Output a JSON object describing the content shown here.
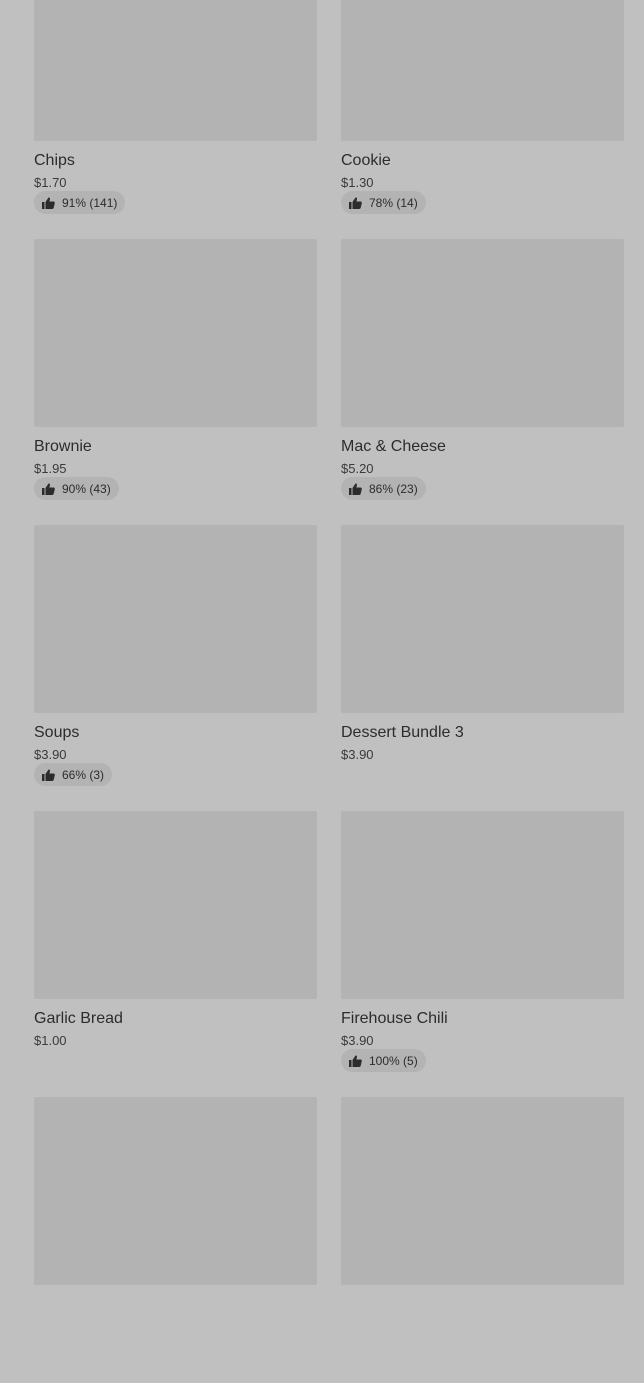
{
  "menu_items": [
    {
      "name": "Chips",
      "price": "$1.70",
      "rating": "91% (141)"
    },
    {
      "name": "Cookie",
      "price": "$1.30",
      "rating": "78% (14)"
    },
    {
      "name": "Brownie",
      "price": "$1.95",
      "rating": "90% (43)"
    },
    {
      "name": "Mac & Cheese",
      "price": "$5.20",
      "rating": "86% (23)"
    },
    {
      "name": "Soups",
      "price": "$3.90",
      "rating": "66% (3)"
    },
    {
      "name": "Dessert Bundle 3",
      "price": "$3.90",
      "rating": ""
    },
    {
      "name": "Garlic Bread",
      "price": "$1.00",
      "rating": ""
    },
    {
      "name": "Firehouse Chili",
      "price": "$3.90",
      "rating": "100% (5)"
    },
    {
      "name": "",
      "price": "",
      "rating": ""
    },
    {
      "name": "",
      "price": "",
      "rating": ""
    }
  ],
  "icons": {
    "rating": "thumbs-up-icon"
  },
  "colors": {
    "background": "#c0c0c0",
    "placeholder": "#b3b3b3",
    "text": "#2c2c2c"
  }
}
